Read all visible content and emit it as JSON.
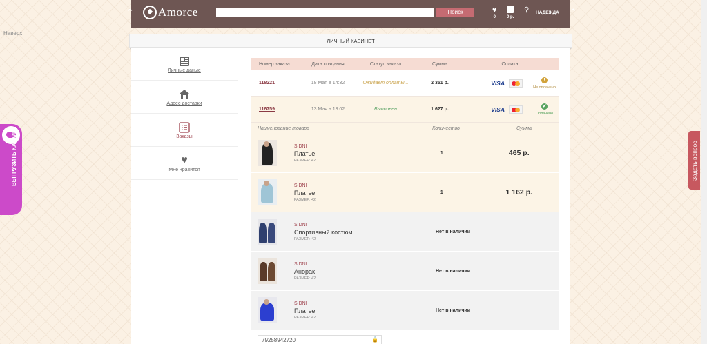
{
  "header": {
    "logo_text": "Amorce",
    "search_placeholder": "",
    "search_button": "Поиск",
    "favorites_count": "0",
    "cart_sum": "0 р.",
    "user_name": "НАДЕЖДА"
  },
  "back_to_top": "Наверх",
  "banner": "ЛИЧНЫЙ КАБИНЕТ",
  "sidebar": {
    "items": [
      {
        "label": "Личные даные",
        "icon": "profile-card-icon"
      },
      {
        "label": "Адрес доставки",
        "icon": "house-icon"
      },
      {
        "label": "Заказы",
        "icon": "list-icon"
      },
      {
        "label": "Мне нравится",
        "icon": "heart-icon"
      }
    ]
  },
  "orders_table": {
    "headers": [
      "Номер заказа",
      "Дата создания",
      "Статус заказа",
      "Сумма",
      "Оплата"
    ],
    "rows": [
      {
        "number": "118221",
        "date": "18 Мая в 14:32",
        "status": "Ожидает оплаты...",
        "sum": "2 351 р.",
        "visa": "VISA",
        "payment_status": "Не оплачено",
        "badge": "!"
      },
      {
        "number": "116759",
        "date": "13 Мая в 13:02",
        "status": "Выполнен",
        "sum": "1 627 р.",
        "visa": "VISA",
        "payment_status": "Оплачено",
        "badge": "✔"
      }
    ]
  },
  "items_table": {
    "headers": [
      "Наименование товара",
      "Количество",
      "Сумма"
    ],
    "rows": [
      {
        "brand": "SIDNI",
        "name": "Платье",
        "size": "РАЗМЕР: 42",
        "qty": "1",
        "price": "465 р."
      },
      {
        "brand": "SIDNI",
        "name": "Платье",
        "size": "РАЗМЕР: 42",
        "qty": "1",
        "price": "1 162 р."
      },
      {
        "brand": "SIDNI",
        "name": "Спортивный костюм",
        "size": "РАЗМЕР: 42",
        "availability": "Нет в наличии"
      },
      {
        "brand": "SIDNI",
        "name": "Анорак",
        "size": "РАЗМЕР: 42",
        "availability": "Нет в наличии"
      },
      {
        "brand": "SIDNI",
        "name": "Платье",
        "size": "РАЗМЕР: 42",
        "availability": "Нет в наличии"
      }
    ]
  },
  "phone_field": {
    "value": "79258942720"
  },
  "left_tab": "ВЫГРУЗИТЬ КАТАЛОГ",
  "right_tab": "Задать вопрос",
  "colors": {
    "header_bg": "#6e5653",
    "accent": "#a04550",
    "search_button": "#c56b72",
    "left_tab": "#cc4ac9",
    "right_tab": "#c7585f"
  }
}
